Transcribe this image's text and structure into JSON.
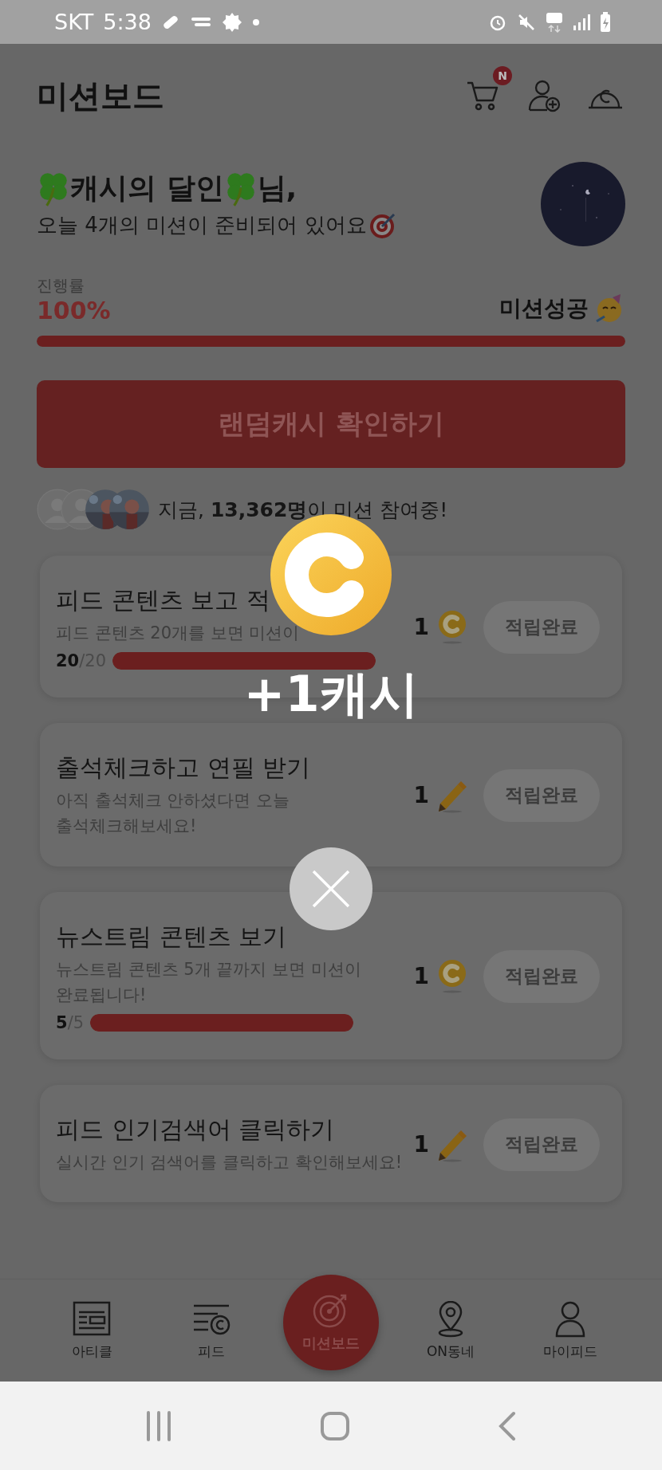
{
  "status_bar": {
    "carrier": "SKT",
    "time": "5:38"
  },
  "header": {
    "title": "미션보드",
    "cart_badge": "N"
  },
  "greeting": {
    "name": "캐시의 달인",
    "suffix": "님,",
    "subtitle": "오늘 4개의 미션이 준비되어 있어요"
  },
  "progress": {
    "label": "진행률",
    "value": "100%",
    "status": "미션성공",
    "level": 1
  },
  "cta_button": "랜덤캐시 확인하기",
  "participants": {
    "avatars": [
      {
        "kind": "generic"
      },
      {
        "kind": "generic"
      },
      {
        "kind": "picture"
      },
      {
        "kind": "picture"
      }
    ],
    "text": "지금, **13,362명**이 미션 참여중!"
  },
  "missions": [
    {
      "title": "피드 콘텐츠 보고 적",
      "description": "피드 콘텐츠 20개를 보면 미션이",
      "reward": "1",
      "kind": "coin",
      "button": "적립완료",
      "progress": {
        "done": "20",
        "total": "/20",
        "level": 1
      }
    },
    {
      "title": "출석체크하고 연필 받기",
      "description": "아직 출석체크 안하셨다면 오늘\n출석체크해보세요!",
      "reward": "1",
      "kind": "pencil",
      "button": "적립완료"
    },
    {
      "title": "뉴스트림 콘텐츠 보기",
      "description": "뉴스트림 콘텐츠 5개 끝까지 보면 미션이\n완료됩니다!",
      "reward": "1",
      "kind": "coin",
      "button": "적립완료",
      "progress": {
        "done": "5",
        "total": "/5",
        "level": 1
      }
    },
    {
      "title": "피드 인기검색어 클릭하기",
      "description": "실시간 인기 검색어를 클릭하고 확인해보세요!",
      "reward": "1",
      "kind": "pencil",
      "button": "적립완료"
    }
  ],
  "popup": {
    "reward": "+1캐시"
  },
  "bottom_nav": [
    {
      "label": "아티클",
      "kind": "article",
      "selected": false
    },
    {
      "label": "피드",
      "kind": "feed",
      "selected": false
    },
    {
      "label": "미션보드",
      "kind": "mission",
      "selected": true
    },
    {
      "label": "ON동네",
      "kind": "place",
      "selected": false
    },
    {
      "label": "마이피드",
      "kind": "person",
      "selected": false
    }
  ]
}
